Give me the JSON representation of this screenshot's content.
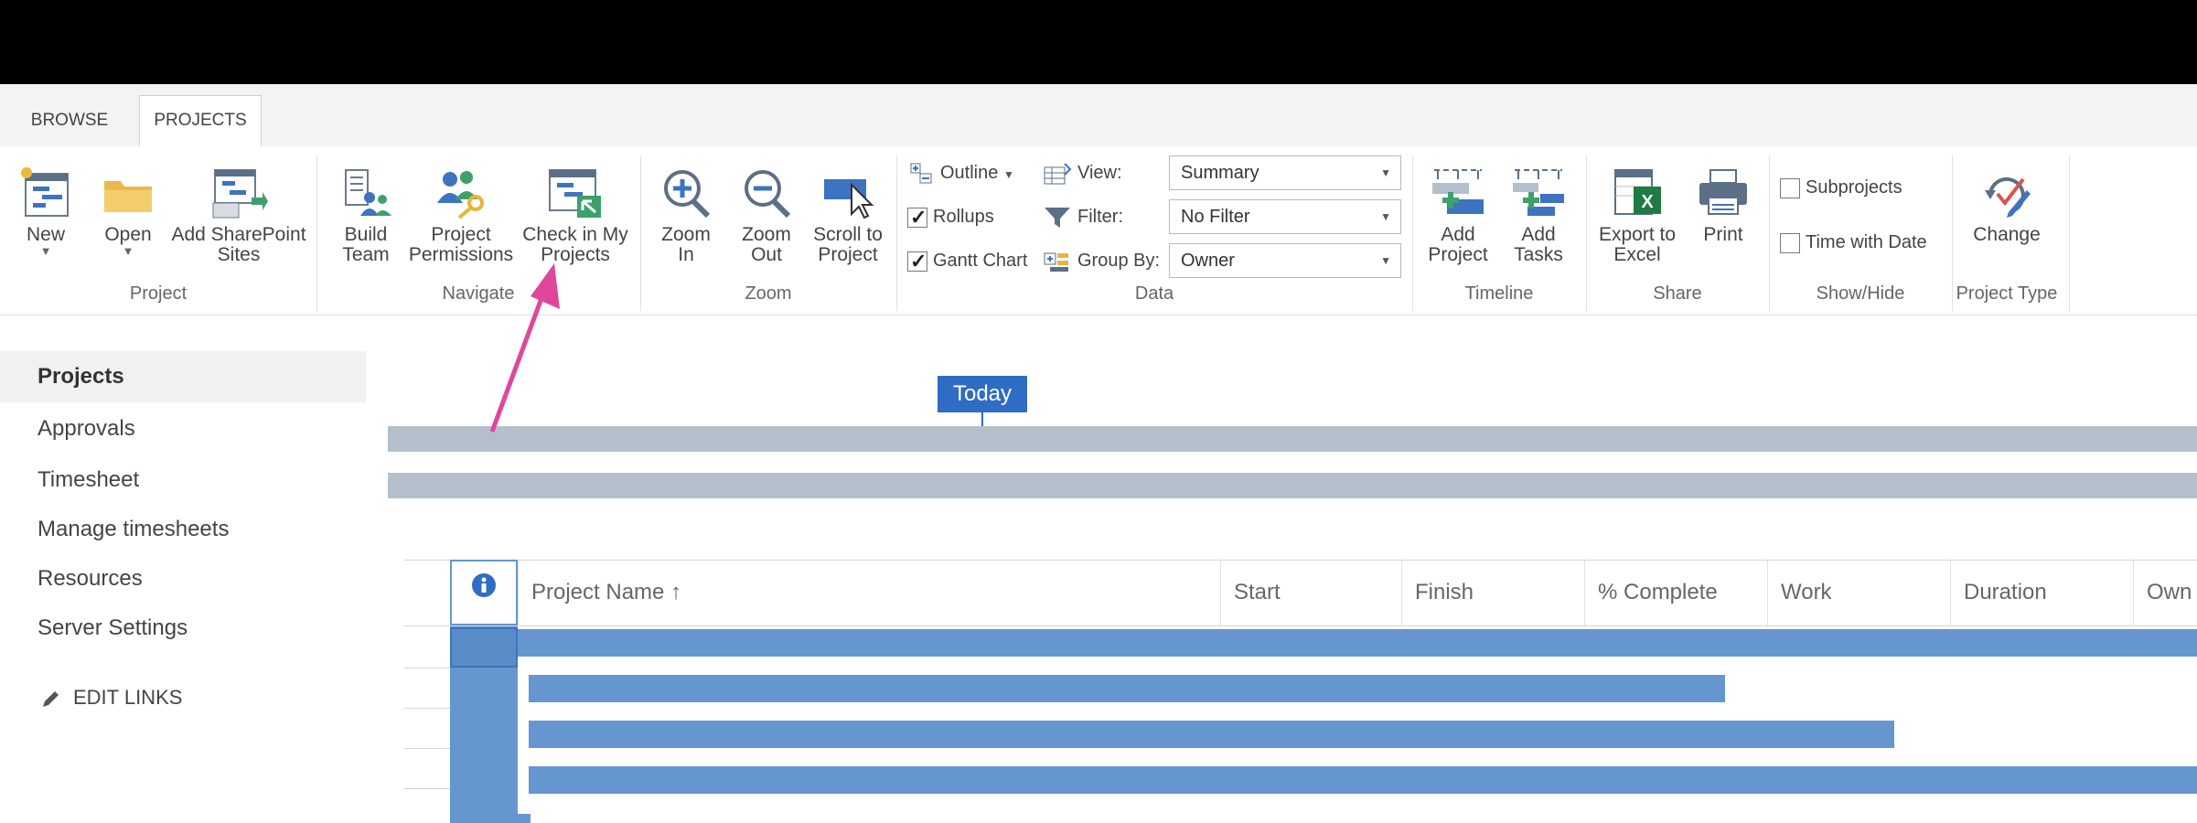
{
  "tabs": [
    {
      "label": "BROWSE",
      "active": false
    },
    {
      "label": "PROJECTS",
      "active": true
    }
  ],
  "ribbon": {
    "project": {
      "group_label": "Project",
      "new": "New",
      "open": "Open",
      "add_sharepoint": [
        "Add SharePoint",
        "Sites"
      ]
    },
    "navigate": {
      "group_label": "Navigate",
      "build_team": [
        "Build",
        "Team"
      ],
      "project_permissions": [
        "Project",
        "Permissions"
      ],
      "check_in": [
        "Check in My",
        "Projects"
      ]
    },
    "zoom": {
      "group_label": "Zoom",
      "zoom_in": [
        "Zoom",
        "In"
      ],
      "zoom_out": [
        "Zoom",
        "Out"
      ],
      "scroll_to_project": [
        "Scroll to",
        "Project"
      ]
    },
    "data": {
      "group_label": "Data",
      "outline": "Outline",
      "rollups": "Rollups",
      "rollups_checked": true,
      "gantt_chart": "Gantt Chart",
      "gantt_checked": true,
      "view_label": "View:",
      "view_value": "Summary",
      "filter_label": "Filter:",
      "filter_value": "No Filter",
      "group_by_label": "Group By:",
      "group_by_value": "Owner"
    },
    "timeline": {
      "group_label": "Timeline",
      "add_project": [
        "Add",
        "Project"
      ],
      "add_tasks": [
        "Add",
        "Tasks"
      ]
    },
    "share": {
      "group_label": "Share",
      "export_excel": [
        "Export to",
        "Excel"
      ],
      "print": "Print"
    },
    "show_hide": {
      "group_label": "Show/Hide",
      "subprojects": "Subprojects",
      "subprojects_checked": false,
      "time_with_date": "Time with Date",
      "time_with_date_checked": false
    },
    "project_type": {
      "group_label": "Project Type",
      "change": "Change"
    }
  },
  "left_nav": {
    "items": [
      "Projects",
      "Approvals",
      "Timesheet",
      "Manage timesheets",
      "Resources",
      "Server Settings"
    ],
    "selected": "Projects",
    "edit_links": "EDIT LINKS"
  },
  "timeline": {
    "today_label": "Today"
  },
  "grid": {
    "columns": [
      "Project Name ↑",
      "Start",
      "Finish",
      "% Complete",
      "Work",
      "Duration",
      "Own"
    ]
  },
  "colors": {
    "accent": "#2f6cc3",
    "gantt_bar": "#6596d0",
    "annotation_arrow": "#e0469c",
    "timeline_bar": "#b3c0cc"
  }
}
